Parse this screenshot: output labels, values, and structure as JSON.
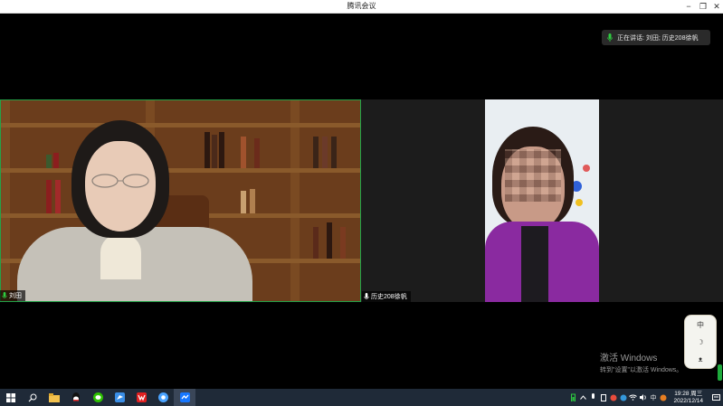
{
  "window": {
    "title": "腾讯会议"
  },
  "window_controls": {
    "minimize": "−",
    "restore": "❐",
    "close": "✕"
  },
  "speaking_banner": {
    "text": "正在讲话: 刘田; 历史208徐帆"
  },
  "participants": [
    {
      "name": "刘田"
    },
    {
      "name": "历史208徐帆"
    }
  ],
  "watermark": {
    "line1": "激活 Windows",
    "line2": "转到\"设置\"以激活 Windows。"
  },
  "ime": {
    "mode": "中",
    "moon": "☽",
    "shirt": "ᴥ"
  },
  "tray": {
    "ime_label": "中",
    "time": "19:28 周三",
    "date": "2022/12/14"
  },
  "colors": {
    "active_speaker_border": "#24a148",
    "mic_green": "#2ecc40",
    "taskbar": "#1f2a38"
  }
}
